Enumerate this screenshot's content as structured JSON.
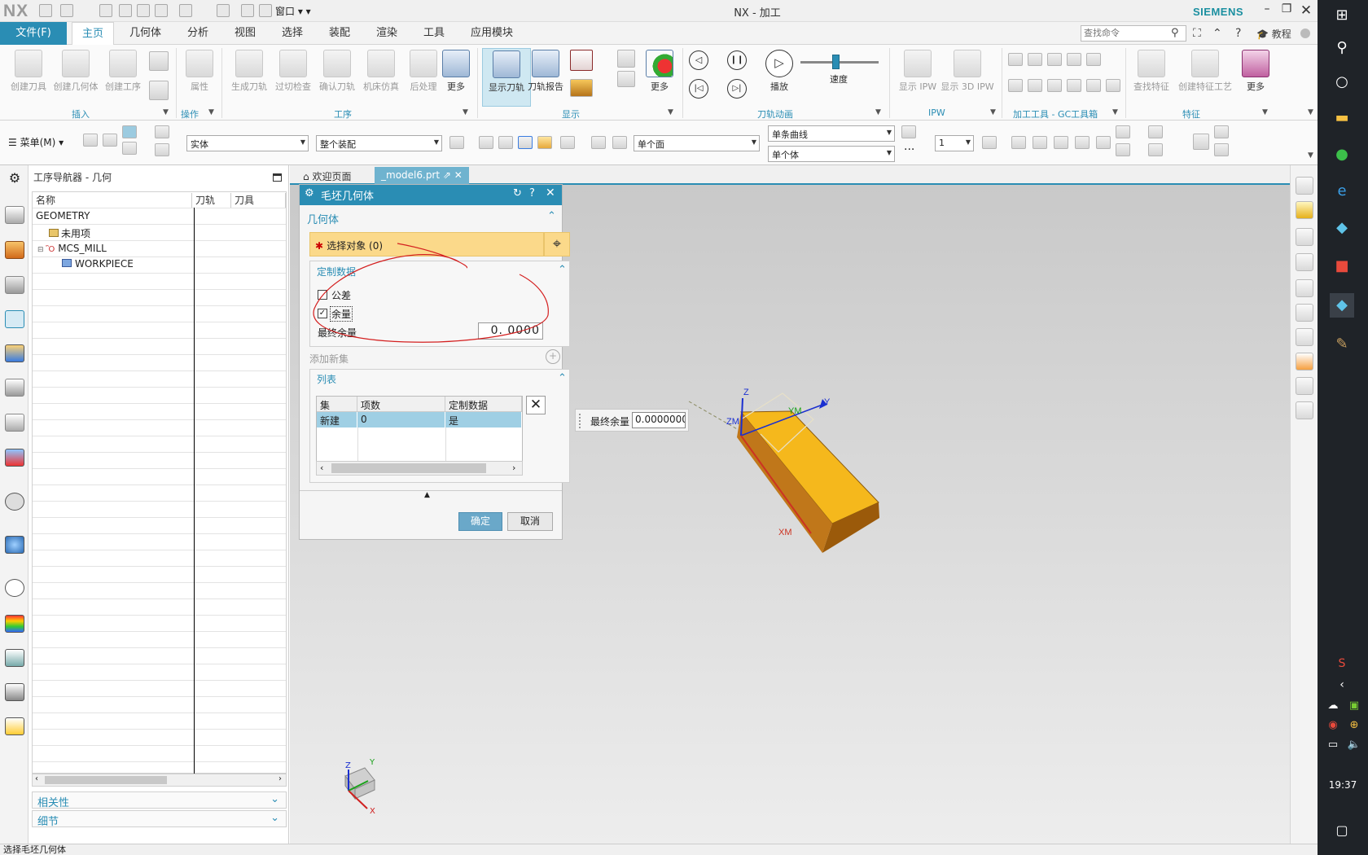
{
  "app": {
    "logo": "NX",
    "title": "NX - 加工",
    "brand": "SIEMENS",
    "quick_window": "窗口"
  },
  "tabs": [
    "文件(F)",
    "主页",
    "几何体",
    "分析",
    "视图",
    "选择",
    "装配",
    "渲染",
    "工具",
    "应用模块"
  ],
  "search": {
    "placeholder": "查找命令"
  },
  "help": {
    "tutorial": "教程"
  },
  "ribbon": {
    "insert": {
      "label": "插入",
      "items": [
        "创建刀具",
        "创建几何体",
        "创建工序"
      ]
    },
    "operation": {
      "label": "操作",
      "items": [
        "属性"
      ]
    },
    "process": {
      "label": "工序",
      "items": [
        "生成刀轨",
        "过切检查",
        "确认刀轨",
        "机床仿真",
        "后处理",
        "更多"
      ]
    },
    "display": {
      "label": "显示",
      "items": [
        "显示刀轨",
        "刀轨报告",
        "更多"
      ]
    },
    "animation": {
      "label": "刀轨动画",
      "play": "播放",
      "speed": "速度"
    },
    "ipw": {
      "label": "IPW",
      "items": [
        "显示 IPW",
        "显示 3D IPW"
      ]
    },
    "gc": {
      "label": "加工工具 - GC工具箱"
    },
    "feature": {
      "label": "特征",
      "items": [
        "查找特征",
        "创建特征工艺",
        "更多"
      ]
    }
  },
  "toolbar2": {
    "menu": "菜单(M)",
    "filter": "实体",
    "assembly": "整个装配",
    "face": "单个面",
    "curve": "单条曲线",
    "body": "单个体",
    "layer": "1",
    "more": "···"
  },
  "navigator": {
    "title": "工序导航器 - 几何",
    "columns": [
      "名称",
      "刀轨",
      "刀具"
    ],
    "rows": [
      {
        "name": "GEOMETRY"
      },
      {
        "name": "未用项"
      },
      {
        "name": "MCS_MILL"
      },
      {
        "name": "WORKPIECE"
      }
    ],
    "panels": [
      "相关性",
      "细节"
    ]
  },
  "doc_tabs": [
    "欢迎页面",
    "_model6.prt"
  ],
  "dialog": {
    "title": "毛坯几何体",
    "section_geometry": "几何体",
    "select_object": "选择对象 (0)",
    "custom_data": "定制数据",
    "tolerance": "公差",
    "stock": "余量",
    "final_stock_label": "最终余量",
    "final_stock_value": "0. 0000",
    "add_new_set": "添加新集",
    "list": "列表",
    "list_headers": [
      "集",
      "项数",
      "定制数据"
    ],
    "list_rows": [
      [
        "新建",
        "0",
        "是"
      ]
    ],
    "ok": "确定",
    "cancel": "取消"
  },
  "onscreen_input": {
    "label": "最终余量",
    "value": "0.0000000"
  },
  "triad_labels": {
    "z": "Z",
    "zm": "ZM",
    "ym": "YM",
    "y": "Y",
    "xm": "XM",
    "x": "X"
  },
  "status": "选择毛坯几何体",
  "taskbar": {
    "time": "19:37"
  },
  "colors": {
    "accent": "#2a8db4",
    "part": "#f5b81c",
    "part_side": "#9b5a0a",
    "selection_bar": "#fbd98a"
  }
}
